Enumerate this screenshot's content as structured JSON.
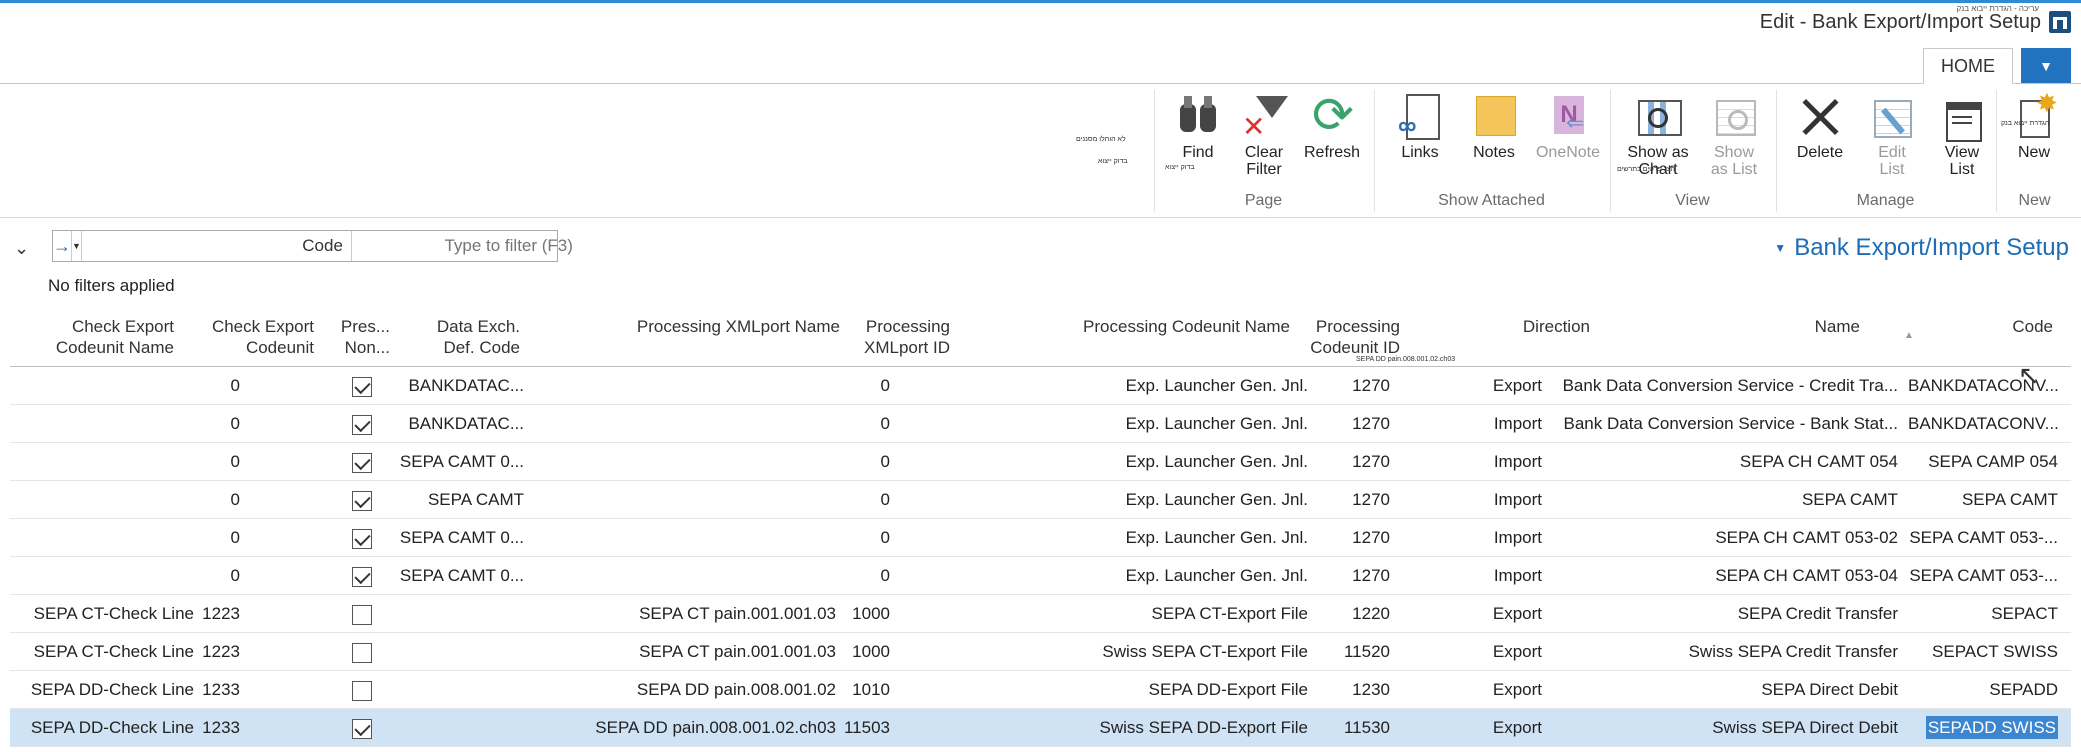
{
  "window": {
    "title": "Edit - Bank Export/Import Setup",
    "subtitle": "עריכה - הגדרת ייבוא בנק"
  },
  "tabs": {
    "file_label": "▼",
    "home_label": "HOME"
  },
  "ribbon": {
    "groups": {
      "new": "New",
      "manage": "Manage",
      "view": "View",
      "show_attached": "Show Attached",
      "page": "Page"
    },
    "buttons": {
      "new": "New",
      "new_note": "הגדרת ייבוא בנק",
      "view_list": "View\nList",
      "edit_list": "Edit\nList",
      "delete": "Delete",
      "show_as_list": "Show\nas List",
      "show_as_chart": "Show as\nChart",
      "chart_note": "הצג פרטים כתרשים",
      "onenote": "OneNote",
      "notes": "Notes",
      "links": "Links",
      "refresh": "Refresh",
      "clear_filter": "Clear\nFilter",
      "find": "Find",
      "find_note": "בדוק ייצוא",
      "side_note_1": "לא הוחלו מסננים",
      "side_note_2": "בדוק ייצוא"
    }
  },
  "page": {
    "title": "Bank Export/Import Setup",
    "filter_field": "Code",
    "filter_placeholder": "Type to filter (F3)",
    "no_filters": "No filters applied"
  },
  "table": {
    "headers": {
      "code": "Code",
      "name": "Name",
      "direction": "Direction",
      "proc_codeunit_id": "Processing\nCodeunit ID",
      "proc_codeunit_name": "Processing Codeunit Name",
      "proc_xmlport_id": "Processing\nXMLport ID",
      "proc_xmlport_name": "Processing XMLport Name",
      "data_exch": "Data Exch.\nDef. Code",
      "pres": "Pres...\nNon...",
      "check_export_cu": "Check Export\nCodeunit",
      "check_export_name": "Check Export\nCodeunit Name"
    },
    "header_tip": "SEPA DD pain.008.001.02.ch03",
    "rows": [
      {
        "code": "BANKDATACONV...",
        "name": "Bank Data Conversion Service - Credit Tra...",
        "direction": "Export",
        "cu_id": "1270",
        "cu_name": "Exp. Launcher Gen. Jnl.",
        "xp_id": "0",
        "xp_name": "",
        "dx": "BANKDATAC...",
        "pres": true,
        "chk_cu": "0",
        "chk_name": ""
      },
      {
        "code": "BANKDATACONV...",
        "name": "Bank Data Conversion Service - Bank Stat...",
        "direction": "Import",
        "cu_id": "1270",
        "cu_name": "Exp. Launcher Gen. Jnl.",
        "xp_id": "0",
        "xp_name": "",
        "dx": "BANKDATAC...",
        "pres": true,
        "chk_cu": "0",
        "chk_name": ""
      },
      {
        "code": "SEPA CAMP 054",
        "name": "SEPA CH CAMT 054",
        "direction": "Import",
        "cu_id": "1270",
        "cu_name": "Exp. Launcher Gen. Jnl.",
        "xp_id": "0",
        "xp_name": "",
        "dx": "SEPA CAMT 0...",
        "pres": true,
        "chk_cu": "0",
        "chk_name": ""
      },
      {
        "code": "SEPA CAMT",
        "name": "SEPA CAMT",
        "direction": "Import",
        "cu_id": "1270",
        "cu_name": "Exp. Launcher Gen. Jnl.",
        "xp_id": "0",
        "xp_name": "",
        "dx": "SEPA CAMT",
        "pres": true,
        "chk_cu": "0",
        "chk_name": ""
      },
      {
        "code": "SEPA CAMT 053-...",
        "name": "SEPA CH CAMT 053-02",
        "direction": "Import",
        "cu_id": "1270",
        "cu_name": "Exp. Launcher Gen. Jnl.",
        "xp_id": "0",
        "xp_name": "",
        "dx": "SEPA CAMT 0...",
        "pres": true,
        "chk_cu": "0",
        "chk_name": ""
      },
      {
        "code": "SEPA CAMT 053-...",
        "name": "SEPA CH CAMT 053-04",
        "direction": "Import",
        "cu_id": "1270",
        "cu_name": "Exp. Launcher Gen. Jnl.",
        "xp_id": "0",
        "xp_name": "",
        "dx": "SEPA CAMT 0...",
        "pres": true,
        "chk_cu": "0",
        "chk_name": ""
      },
      {
        "code": "SEPACT",
        "name": "SEPA Credit Transfer",
        "direction": "Export",
        "cu_id": "1220",
        "cu_name": "SEPA CT-Export File",
        "xp_id": "1000",
        "xp_name": "SEPA CT pain.001.001.03",
        "dx": "",
        "pres": false,
        "chk_cu": "1223",
        "chk_name": "SEPA CT-Check Line"
      },
      {
        "code": "SEPACT SWISS",
        "name": "Swiss SEPA Credit Transfer",
        "direction": "Export",
        "cu_id": "11520",
        "cu_name": "Swiss SEPA CT-Export File",
        "xp_id": "1000",
        "xp_name": "SEPA CT pain.001.001.03",
        "dx": "",
        "pres": false,
        "chk_cu": "1223",
        "chk_name": "SEPA CT-Check Line"
      },
      {
        "code": "SEPADD",
        "name": "SEPA Direct Debit",
        "direction": "Export",
        "cu_id": "1230",
        "cu_name": "SEPA DD-Export File",
        "xp_id": "1010",
        "xp_name": "SEPA DD pain.008.001.02",
        "dx": "",
        "pres": false,
        "chk_cu": "1233",
        "chk_name": "SEPA DD-Check Line"
      },
      {
        "code": "SEPADD SWISS",
        "name": "Swiss SEPA Direct Debit",
        "direction": "Export",
        "cu_id": "11530",
        "cu_name": "Swiss SEPA DD-Export File",
        "xp_id": "11503",
        "xp_name": "SEPA DD pain.008.001.02.ch03",
        "dx": "",
        "pres": true,
        "chk_cu": "1233",
        "chk_name": "SEPA DD-Check Line",
        "selected": true
      }
    ]
  },
  "colors": {
    "accent": "#2173c0",
    "title_blue": "#1e6cb6",
    "selection": "#cfe3f5"
  }
}
